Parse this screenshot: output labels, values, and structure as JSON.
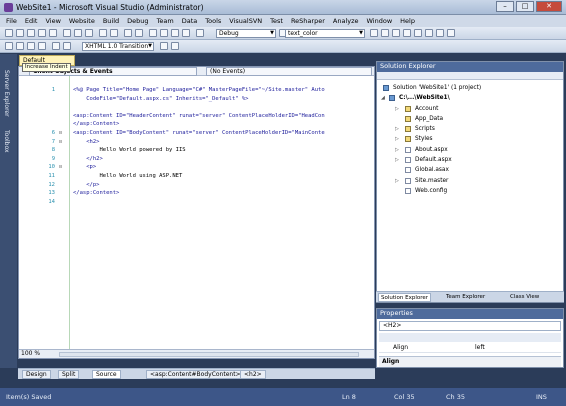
{
  "window": {
    "title": "WebSite1 - Microsoft Visual Studio (Administrator)",
    "buttons": {
      "minimize": "–",
      "maximize": "□",
      "close": "✕"
    }
  },
  "menu": [
    "File",
    "Edit",
    "View",
    "Website",
    "Build",
    "Debug",
    "Team",
    "Data",
    "Tools",
    "VisualSVN",
    "Test",
    "ReSharper",
    "Analyze",
    "Window",
    "Help"
  ],
  "toolbar": {
    "config": "Debug",
    "find": "text_color",
    "doctype": "XHTML 1.0 Transition"
  },
  "left_tabs": [
    "Server Explorer",
    "Toolbox"
  ],
  "document": {
    "tab": "Default",
    "tooltip": "Increase Indent",
    "nav_left": "Client Objects & Events",
    "nav_right": "(No Events)",
    "lines": [
      {
        "n": "1",
        "fold": "",
        "text": "<%@ Page Title=\"Home Page\" Language=\"C#\" MasterPageFile=\"~/Site.master\" Auto"
      },
      {
        "n": "",
        "fold": "",
        "text": "    CodeFile=\"Default.aspx.cs\" Inherits=\"_Default\" %>"
      },
      {
        "n": "",
        "fold": "",
        "text": ""
      },
      {
        "n": "",
        "fold": "",
        "text": "<asp:Content ID=\"HeaderContent\" runat=\"server\" ContentPlaceHolderID=\"HeadCon"
      },
      {
        "n": "",
        "fold": "",
        "text": "</asp:Content>"
      },
      {
        "n": "6",
        "fold": "⊟",
        "text": "<asp:Content ID=\"BodyContent\" runat=\"server\" ContentPlaceHolderID=\"MainConte"
      },
      {
        "n": "7",
        "fold": "⊟",
        "text": "    <h2>"
      },
      {
        "n": "8",
        "fold": "",
        "text": "        Hello World powered by IIS"
      },
      {
        "n": "9",
        "fold": "",
        "text": "    </h2>"
      },
      {
        "n": "10",
        "fold": "⊟",
        "text": "    <p>"
      },
      {
        "n": "11",
        "fold": "",
        "text": "        Hello World using ASP.NET"
      },
      {
        "n": "12",
        "fold": "",
        "text": "    </p>"
      },
      {
        "n": "13",
        "fold": "",
        "text": "</asp:Content>"
      },
      {
        "n": "14",
        "fold": "",
        "text": ""
      }
    ],
    "zoom": "100 %"
  },
  "view_bar": {
    "design": "Design",
    "split": "Split",
    "source": "Source",
    "crumb1": "<asp:Content#BodyContent>",
    "crumb2": "<h2>"
  },
  "solution_explorer": {
    "title": "Solution Explorer",
    "items": [
      {
        "label": "Solution 'WebSite1' (1 project)",
        "indent": 0,
        "kind": "root",
        "exp": ""
      },
      {
        "label": "C:\\...\\WebSite1\\",
        "indent": 1,
        "kind": "root",
        "exp": "◢"
      },
      {
        "label": "Account",
        "indent": 2,
        "kind": "folder",
        "exp": "▷"
      },
      {
        "label": "App_Data",
        "indent": 2,
        "kind": "folder",
        "exp": ""
      },
      {
        "label": "Scripts",
        "indent": 2,
        "kind": "folder",
        "exp": "▷"
      },
      {
        "label": "Styles",
        "indent": 2,
        "kind": "folder",
        "exp": "▷"
      },
      {
        "label": "About.aspx",
        "indent": 2,
        "kind": "file",
        "exp": "▷"
      },
      {
        "label": "Default.aspx",
        "indent": 2,
        "kind": "file",
        "exp": "▷"
      },
      {
        "label": "Global.asax",
        "indent": 2,
        "kind": "file",
        "exp": ""
      },
      {
        "label": "Site.master",
        "indent": 2,
        "kind": "file",
        "exp": "▷"
      },
      {
        "label": "Web.config",
        "indent": 2,
        "kind": "file",
        "exp": ""
      }
    ],
    "tabs": [
      "Solution Explorer",
      "Team Explorer",
      "Class View"
    ]
  },
  "properties": {
    "title": "Properties",
    "object": "<H2>",
    "row_name": "Align",
    "row_value": "left",
    "desc": "Align"
  },
  "status": {
    "message": "Item(s) Saved",
    "ln": "Ln 8",
    "col": "Col 35",
    "ch": "Ch 35",
    "mode": "INS"
  }
}
